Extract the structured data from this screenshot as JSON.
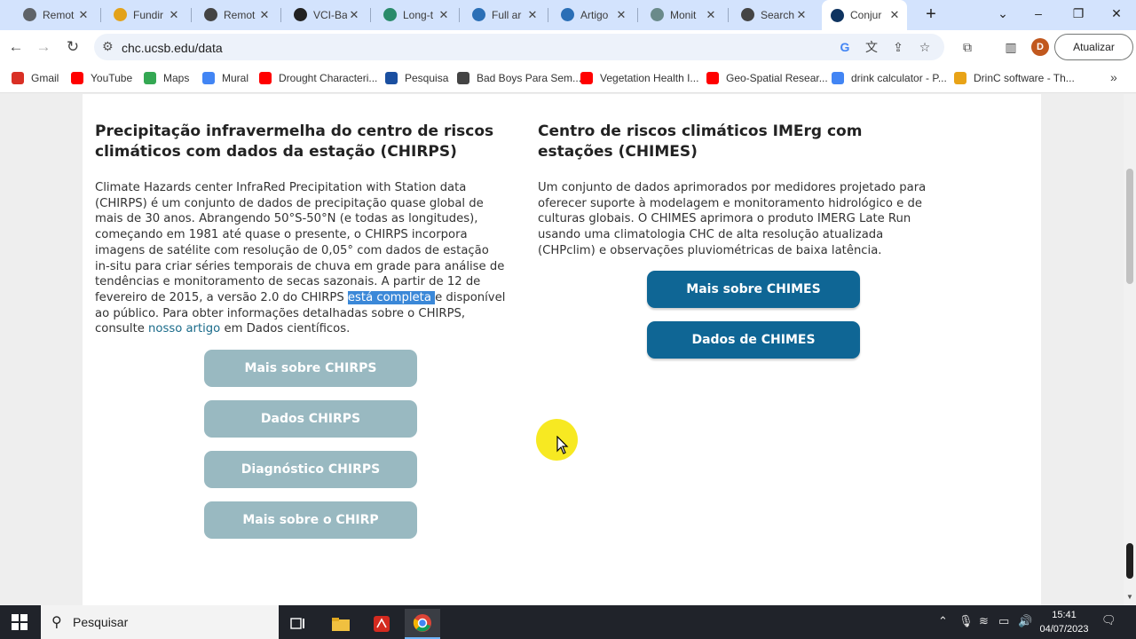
{
  "browser": {
    "tabs": [
      {
        "title": "Remot",
        "icon": "globe-icon",
        "color": "#5f6368"
      },
      {
        "title": "Fundir",
        "icon": "fund-icon",
        "color": "#e3a21a"
      },
      {
        "title": "Remot",
        "icon": "lock-doc-icon",
        "color": "#444444"
      },
      {
        "title": "VCI-Ba",
        "icon": "bookmark-icon",
        "color": "#222222"
      },
      {
        "title": "Long-t",
        "icon": "link-icon",
        "color": "#2a8b6a"
      },
      {
        "title": "Full ar",
        "icon": "image-icon",
        "color": "#2b6fb6"
      },
      {
        "title": "Artigo",
        "icon": "image-icon",
        "color": "#2b6fb6"
      },
      {
        "title": "Monit",
        "icon": "ring-icon",
        "color": "#6a8a8a"
      },
      {
        "title": "Search",
        "icon": "search-tab-icon",
        "color": "#444444"
      },
      {
        "title": "Conjur",
        "icon": "ucsb-icon",
        "color": "#0f3460"
      }
    ],
    "url": "chc.ucsb.edu/data",
    "update_label": "Atualizar",
    "profile_initial": "D",
    "bookmarks": [
      {
        "label": "Gmail",
        "color": "#d93025"
      },
      {
        "label": "YouTube",
        "color": "#ff0000"
      },
      {
        "label": "Maps",
        "color": "#34a853"
      },
      {
        "label": "Mural",
        "color": "#4285f4"
      },
      {
        "label": "Drought Characteri...",
        "color": "#ff0000"
      },
      {
        "label": "Pesquisa",
        "color": "#1a4fa0"
      },
      {
        "label": "Bad Boys Para Sem...",
        "color": "#444444"
      },
      {
        "label": "Vegetation Health I...",
        "color": "#ff0000"
      },
      {
        "label": "Geo-Spatial Resear...",
        "color": "#ff0000"
      },
      {
        "label": "drink calculator - P...",
        "color": "#4285f4"
      },
      {
        "label": "DrinC software - Th...",
        "color": "#e8a317"
      }
    ]
  },
  "page": {
    "chirps": {
      "heading": "Precipitação infravermelha do centro de riscos climáticos com dados da estação (CHIRPS)",
      "para_part1": "Climate Hazards center InfraRed Precipitation with Station data (CHIRPS) é um conjunto de dados de precipitação quase global de mais de 30 anos. Abrangendo 50°S-50°N (e todas as longitudes), começando em 1981 até quase o presente, o CHIRPS incorpora imagens de satélite com resolução de 0,05° com dados de estação in-situ para criar séries temporais de chuva em grade para análise de tendências e monitoramento de secas sazonais. A partir de 12 de fevereiro de 2015, a versão 2.0 do CHIRPS ",
      "para_selected": "está completa ",
      "para_part2": "e disponível ao público. Para obter informações detalhadas sobre o CHIRPS, consulte ",
      "para_link": "nosso artigo",
      "para_part3": " em Dados científicos.",
      "buttons": [
        "Mais sobre CHIRPS",
        "Dados CHIRPS",
        "Diagnóstico CHIRPS",
        "Mais sobre o CHIRP"
      ]
    },
    "chimes": {
      "heading": "Centro de riscos climáticos IMErg com estações (CHIMES)",
      "para": "Um conjunto de dados aprimorados por medidores projetado para oferecer suporte à modelagem e monitoramento hidrológico e de culturas globais. O CHIMES aprimora o produto IMERG Late Run usando uma climatologia CHC de alta resolução atualizada (CHPclim) e observações pluviométricas de baixa latência.",
      "buttons": [
        "Mais sobre CHIMES",
        "Dados de CHIMES"
      ]
    }
  },
  "taskbar": {
    "search_placeholder": "Pesquisar",
    "time": "15:41",
    "date": "04/07/2023"
  },
  "colors": {
    "button_light": "#99b9c1",
    "button_dark": "#0f6695",
    "selection": "#3b88d8",
    "link": "#1a6b8a"
  }
}
